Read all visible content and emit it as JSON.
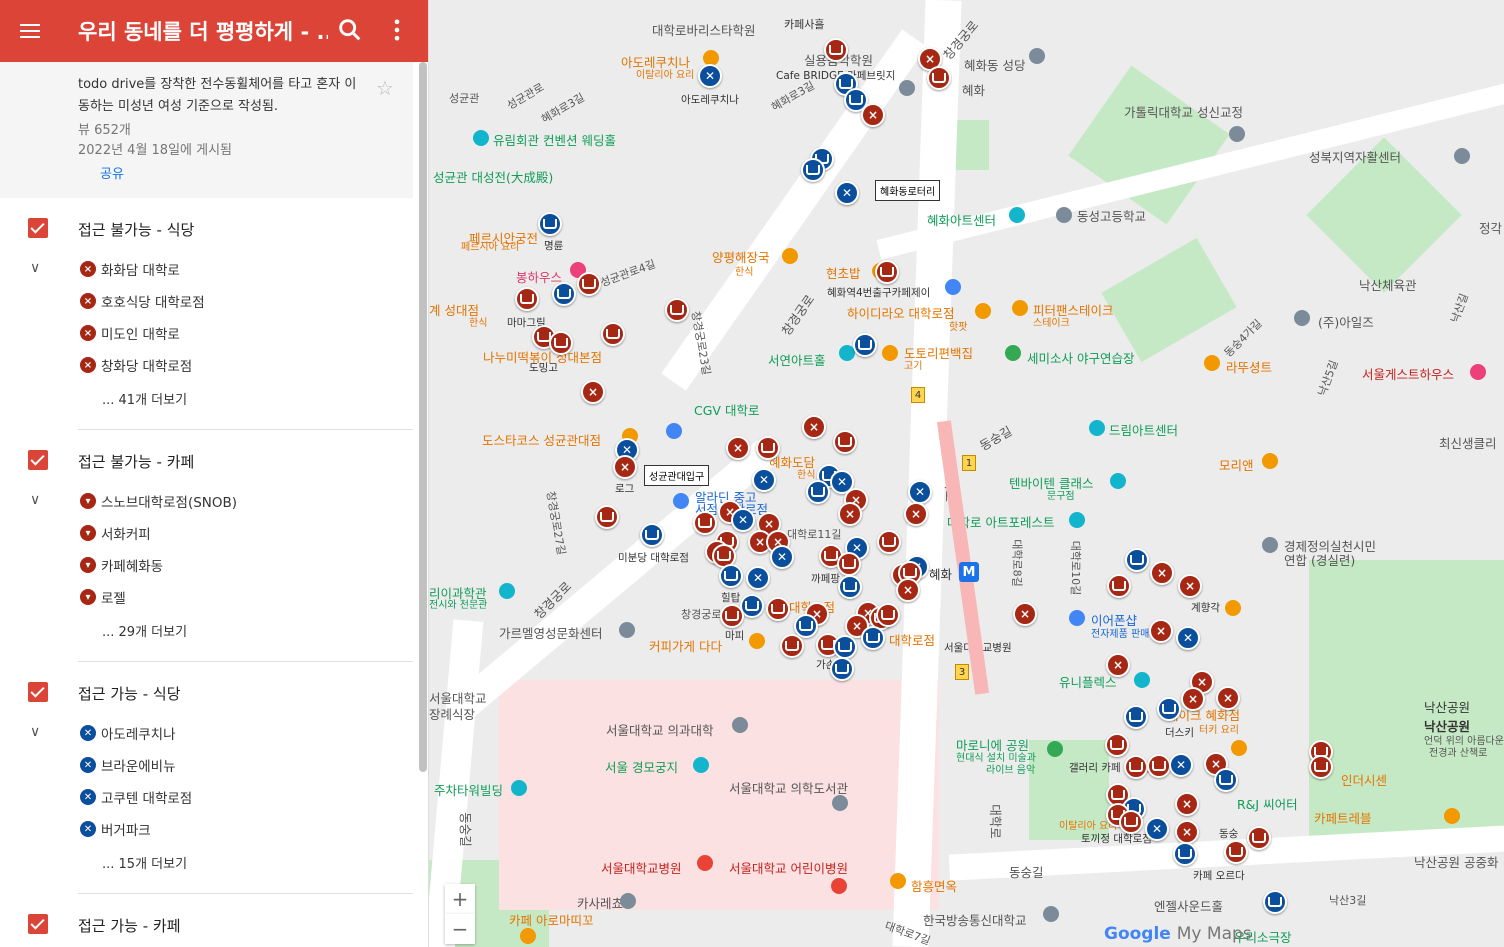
{
  "header": {
    "title": "우리 동네를 더 평평하게 - ..."
  },
  "info": {
    "description": "todo drive를 장착한 전수동휠체어를 타고 혼자 이동하는 미성년 여성 기준으로 작성됨.",
    "views": "뷰 652개",
    "date": "2022년 4월 18일에 게시됨",
    "share": "공유"
  },
  "layers": [
    {
      "name": "접근 불가능 - 식당",
      "items": [
        "화화담 대학로",
        "호호식당 대학로점",
        "미도인 대학로",
        "창화당 대학로점"
      ],
      "more": "... 41개 더보기"
    },
    {
      "name": "접근 불가능 - 카페",
      "items": [
        "스노브대학로점(SNOB)",
        "서화커피",
        "카페혜화동",
        "로젤"
      ],
      "more": "... 29개 더보기"
    },
    {
      "name": "접근 가능 - 식당",
      "items": [
        "아도레쿠치나",
        "브라운에비뉴",
        "고쿠텐 대학로점",
        "버거파크"
      ],
      "more": "... 15개 더보기"
    },
    {
      "name": "접근 가능 - 카페"
    }
  ],
  "map": {
    "labels": {
      "l1": "대학로바리스타학원",
      "l2": "카페사흘",
      "l3": "아도레쿠치나",
      "l4": "이탈리아 요리",
      "l5": "아도레쿠치나",
      "l6": "Cafe BRIDGE 카페브릿지",
      "l7": "혜화로3길",
      "l8": "실용음악학원",
      "l9": "혜화동 성당",
      "l10": "혜화",
      "l11": "성균관",
      "l12": "성균관로",
      "l13": "혜화로3길",
      "l14": "가톨릭대학교 성신교정",
      "l15": "유림회관 컨벤션 웨딩홀",
      "l16": "성북지역자활센터",
      "l17": "성균관 대성전(大成殿)",
      "l18": "혜화동로터리",
      "l19": "혜화아트센터",
      "l20": "동성고등학교",
      "l21": "페르시안궁전",
      "l22": "페르시아 요리",
      "l23": "명륜",
      "l24": "양평해장국",
      "l25": "한식",
      "l26": "현초밥",
      "l27": "봉하우스",
      "l28": "성균관로4길",
      "l29": "혜화역4번출구카페제이",
      "l30": "낙산체육관",
      "l31": "계 성대점",
      "l32": "한식",
      "l33": "마마그릴",
      "l34": "하이디라오 대학로점",
      "l35": "핫팟",
      "l36": "피터팬스테이크",
      "l37": "스테이크",
      "l38": "(주)아일즈",
      "l39": "나누미떡볶이 성대본점",
      "l40": "도밍고",
      "l41": "서연아트홀",
      "l42": "도토리편백집",
      "l43": "고기",
      "l44": "세미소사 야구연습장",
      "l45": "라뚜셩트",
      "l46": "서울게스트하우스",
      "l47": "CGV 대학로",
      "l48": "드림아트센터",
      "l49": "도스타코스 성균관대점",
      "l50": "혜화도담",
      "l51": "한식",
      "l52": "성균관대입구",
      "l53": "최신생클리",
      "l54": "알라딘 중고",
      "l55": "서점 대학로점",
      "l56": "로그",
      "l57": "텐바이텐 클래스",
      "l58": "문구점",
      "l59": "모리앤",
      "l60": "대학로 아트포레스트",
      "l61": "미분당 대학로점",
      "l62": "대학로11길",
      "l63": "혜화",
      "l64": "경제정의실천시민",
      "l65": "연합 (경실련)",
      "l66": "까페팡",
      "l67": "힐탑",
      "l68": "창경궁로",
      "l69": "리이과학관",
      "l70": "전시와 천문관",
      "l71": "대학로점",
      "l72": "이어폰샵",
      "l73": "전자제품 판매",
      "l74": "계향각",
      "l75": "가르멜영성문화센터",
      "l76": "커피가게 다다",
      "l77": "마피",
      "l78": "가손",
      "l79": "대학로점",
      "l80": "서울대학교병원",
      "l81": "유니플렉스",
      "l82": "서울대학교",
      "l83": "장례식장",
      "l84": "서울대학교 의과대학",
      "l85": "낙산공원",
      "l86": "더스키",
      "l87": "테이크 혜화점",
      "l88": "터키 요리",
      "l89": "서울 경모궁지",
      "l90": "마로니에 공원",
      "l91": "현대식 설치 미술과",
      "l92": "라이브 음악",
      "l93": "갤러리 카페 드로잉",
      "l94": "인더시센",
      "l95": "주차타워빌딩",
      "l96": "서울대학교 의학도서관",
      "l97": "R&J 씨어터",
      "l98": "카페트레블",
      "l99": "낙산공원",
      "l100": "언덕 위의 아름다운",
      "l101": "전경과 산책로",
      "l102": "토끼정 대학로점",
      "l103": "이탈리아 요리",
      "l104": "동숭",
      "l105": "카페 오르다",
      "l106": "서울대학교병원",
      "l107": "서울대학교 어린이병원",
      "l108": "함흥면옥",
      "l109": "동숭길",
      "l110": "낙산공원 공중화",
      "l111": "카사레쵸",
      "l112": "카페 아로마띠꼬",
      "l113": "엔젤사운드홀",
      "l114": "한국방송통신대학교",
      "l115": "우리소극장",
      "l116": "낙산3길",
      "l117": "대학로7길",
      "l118": "대학로",
      "l119": "창경궁로",
      "l120": "창경궁로",
      "l121": "동숭길",
      "l122": "대학로",
      "l123": "창경궁로",
      "l124": "창경궁로23길",
      "l125": "창경궁로27길",
      "l126": "대학로8길",
      "l127": "대학로10길",
      "l128": "낙산길",
      "l129": "정각",
      "l130": "동숭4가길",
      "l131": "동숭길",
      "l132": "낙산5길"
    },
    "tags": {
      "t1": "혜화동로터리",
      "t2": "성균관대입구"
    },
    "metro": {
      "m1": "4",
      "m2": "1",
      "m3": "3",
      "station": "M"
    },
    "zoom_in": "+",
    "zoom_out": "−",
    "logo_google": "Google",
    "logo_mymaps": "My Maps"
  },
  "colors": {
    "header": "#db4437",
    "inaccessible": "#a52714",
    "accessible": "#0b4f9c"
  }
}
